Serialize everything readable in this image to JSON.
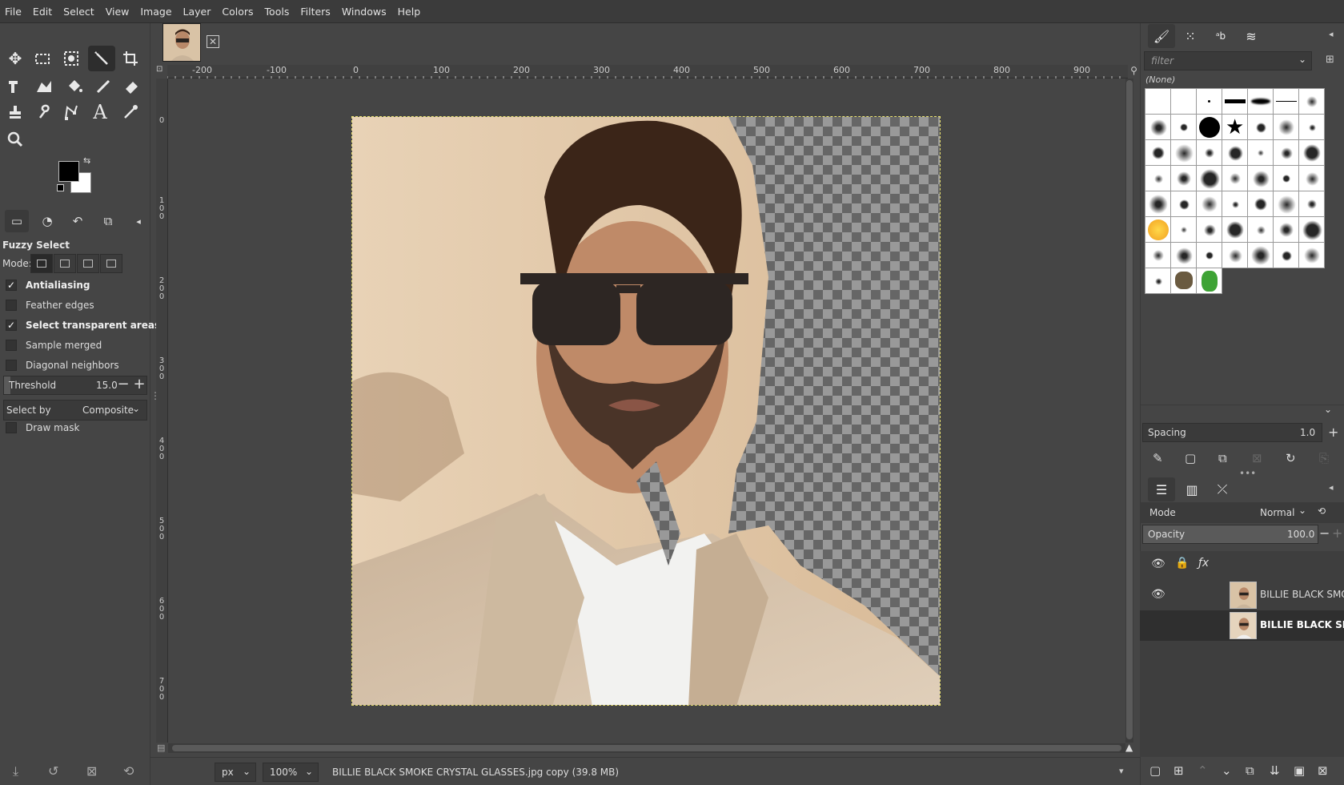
{
  "menubar": {
    "items": [
      "File",
      "Edit",
      "Select",
      "View",
      "Image",
      "Layer",
      "Colors",
      "Tools",
      "Filters",
      "Windows",
      "Help"
    ]
  },
  "toolbox": {
    "tools": [
      "move-tool",
      "rect-select-tool",
      "free-select-tool",
      "fuzzy-select-tool",
      "crop-tool",
      "unified-transform-tool",
      "warp-transform-tool",
      "bucket-fill-tool",
      "paintbrush-tool",
      "eraser-tool",
      "clone-tool",
      "smudge-tool",
      "paths-tool",
      "text-tool",
      "color-picker-tool",
      "zoom-tool"
    ],
    "colors": {
      "foreground": "#000000",
      "background": "#ffffff"
    }
  },
  "tool_options": {
    "title": "Fuzzy Select",
    "mode_label": "Mode:",
    "checkboxes": [
      {
        "label": "Antialiasing",
        "checked": true
      },
      {
        "label": "Feather edges",
        "checked": false
      },
      {
        "label": "Select transparent areas",
        "checked": true
      },
      {
        "label": "Sample merged",
        "checked": false
      },
      {
        "label": "Diagonal neighbors",
        "checked": false
      }
    ],
    "threshold_label": "Threshold",
    "threshold_value": "15.0",
    "select_by_label": "Select by",
    "select_by_value": "Composite",
    "draw_mask_label": "Draw mask"
  },
  "ruler": {
    "top_labels": [
      "-200",
      "-100",
      "0",
      "100",
      "200",
      "300",
      "400",
      "500",
      "600",
      "700",
      "800",
      "900"
    ],
    "left_labels": [
      "0",
      "100",
      "200",
      "300",
      "400",
      "500",
      "600",
      "700"
    ]
  },
  "statusbar": {
    "unit": "px",
    "zoom": "100%",
    "text": "BILLIE BLACK SMOKE CRYSTAL GLASSES.jpg copy (39.8 MB)"
  },
  "brushes": {
    "filter_placeholder": "filter",
    "selected": "(None)",
    "spacing_label": "Spacing",
    "spacing_value": "1.0"
  },
  "layers": {
    "mode_label": "Mode",
    "mode_value": "Normal",
    "opacity_label": "Opacity",
    "opacity_value": "100.0",
    "items": [
      {
        "name": "BILLIE BLACK SMOKE",
        "visible": true,
        "active": false
      },
      {
        "name": "BILLIE BLACK SMOKE",
        "visible": false,
        "active": true
      }
    ]
  }
}
